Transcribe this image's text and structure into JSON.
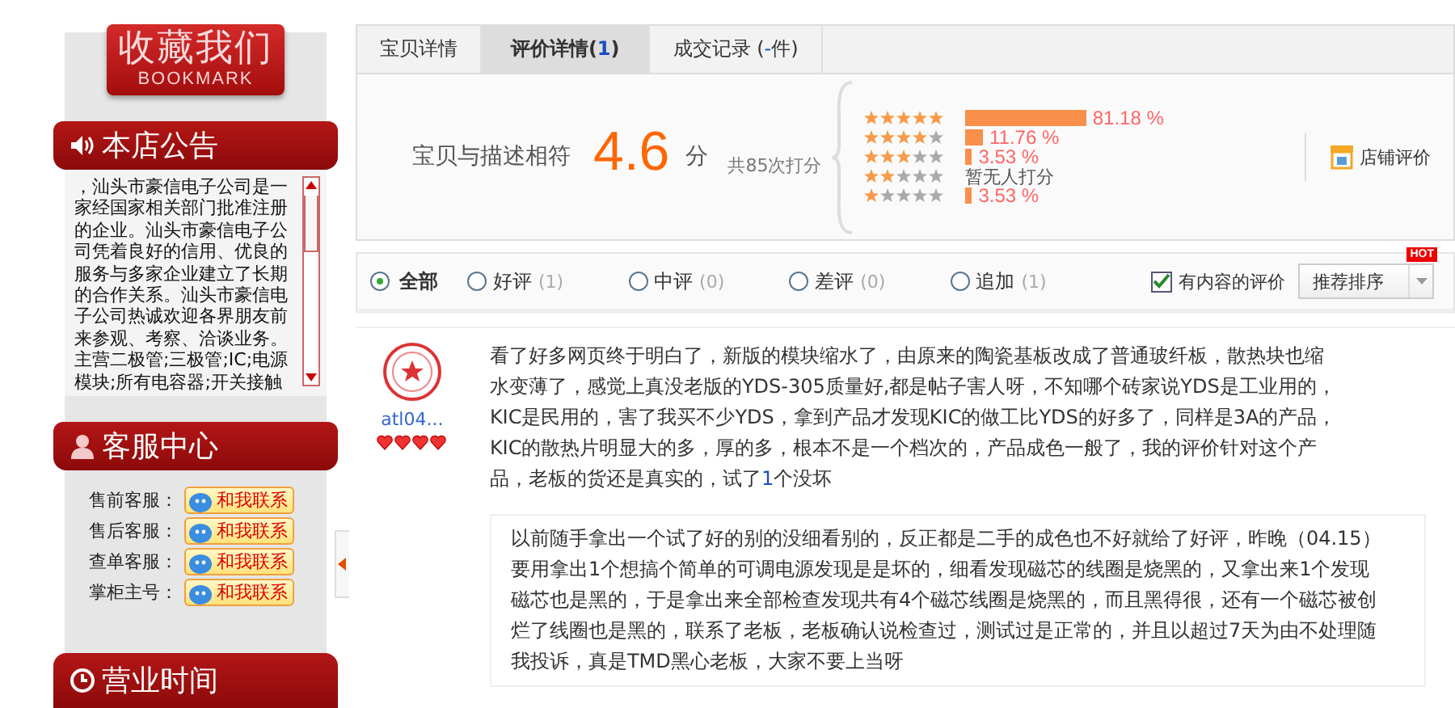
{
  "sidebar": {
    "bookmark": {
      "title": "收藏我们",
      "subtitle": "BOOKMARK"
    },
    "notice": {
      "title": "本店公告",
      "text": "，汕头市豪信电子公司是一家经国家相关部门批准注册的企业。汕头市豪信电子公司凭着良好的信用、优良的服务与多家企业建立了长期的合作关系。汕头市豪信电子公司热诚欢迎各界朋友前来参观、考察、洽谈业务。主营二极管;三极管;IC;电源模块;所有电容器;开关接触"
    },
    "service": {
      "title": "客服中心",
      "contacts": [
        {
          "label": "售前客服：",
          "button": "和我联系"
        },
        {
          "label": "售后客服：",
          "button": "和我联系"
        },
        {
          "label": "查单客服：",
          "button": "和我联系"
        },
        {
          "label": "掌柜主号：",
          "button": "和我联系"
        }
      ]
    },
    "hours": {
      "title": "营业时间"
    }
  },
  "tabs": [
    {
      "parts": [
        {
          "kind": "plain",
          "text": "宝贝详情"
        }
      ],
      "selected": false
    },
    {
      "parts": [
        {
          "kind": "plain",
          "text": "评价详情("
        },
        {
          "kind": "count",
          "text": "1"
        },
        {
          "kind": "plain",
          "text": ")"
        }
      ],
      "selected": true
    },
    {
      "parts": [
        {
          "kind": "plain",
          "text": "成交记录 ("
        },
        {
          "kind": "count",
          "text": "-"
        },
        {
          "kind": "plain",
          "text": "件)"
        }
      ],
      "selected": false
    }
  ],
  "rating": {
    "label": "宝贝与描述相符",
    "score": "4.6",
    "unit": "分",
    "total": "共85次打分",
    "rows": [
      {
        "stars": 5,
        "kind": "bar",
        "reading": "81.18 %"
      },
      {
        "stars": 4,
        "kind": "bar",
        "reading": "11.76 %"
      },
      {
        "stars": 3,
        "kind": "bar",
        "reading": "3.53 %"
      },
      {
        "stars": 2,
        "kind": "note",
        "reading": "暂无人打分"
      },
      {
        "stars": 1,
        "kind": "bar",
        "reading": "3.53 %"
      }
    ],
    "shop_link": "店铺评价"
  },
  "filters": [
    {
      "label": "全部",
      "selected": true
    },
    {
      "label": "好评",
      "count": "(1)",
      "selected": false
    },
    {
      "label": "中评",
      "count": "(0)",
      "selected": false
    },
    {
      "label": "差评",
      "count": "(0)",
      "selected": false
    },
    {
      "label": "追加",
      "count": "(1)",
      "selected": false
    }
  ],
  "content_only": {
    "label": "有内容的评价",
    "checked": true
  },
  "sort": {
    "value": "推荐排序",
    "badge": "HOT"
  },
  "review": {
    "user": "atl04...",
    "stars": 4,
    "parts": [
      {
        "kind": "plain",
        "text": "看了好多网页终于明白了，新版的模块缩水了，由原来的陶瓷基板改成了普通玻纤板，散热块也缩水变薄了，感觉上真没老版的YDS-305质量好,都是帖子害人呀，不知哪个砖家说YDS是工业用的，KIC是民用的，害了我买不少YDS，拿到产品才发现KIC的做工比YDS的好多了，同样是3A的产品，KIC的散热片明显大的多，厚的多，根本不是一个档次的，产品成色一般了，我的评价针对这个产品，老板的货还是真实的，试了"
      },
      {
        "kind": "count",
        "text": "1"
      },
      {
        "kind": "plain",
        "text": "个没坏"
      }
    ],
    "followup": "以前随手拿出一个试了好的别的没细看别的，反正都是二手的成色也不好就给了好评，昨晚（04.15）要用拿出1个想搞个简单的可调电源发现是是坏的，细看发现磁芯的线圈是烧黑的，又拿出来1个发现磁芯也是黑的，于是拿出来全部检查发现共有4个磁芯线圈是烧黑的，而且黑得很，还有一个磁芯被创烂了线圈也是黑的，联系了老板，老板确认说检查过，测试过是正常的，并且以超过7天为由不处理随我投诉，真是TMD黑心老板，大家不要上当呀"
  }
}
